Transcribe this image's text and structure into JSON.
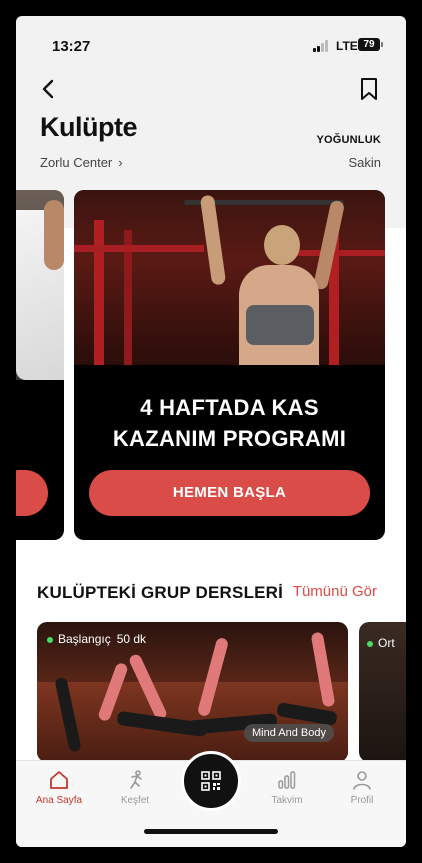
{
  "status_bar": {
    "time": "13:27",
    "network": "LTE",
    "battery": "79"
  },
  "header": {
    "title": "Kulüpte",
    "club_name": "Zorlu Center",
    "density_label": "YOĞUNLUK",
    "density_value": "Sakin"
  },
  "promo_card": {
    "title_line1": "4 HAFTADA KAS",
    "title_line2": "KAZANIM PROGRAMI",
    "button_label": "HEMEN BAŞLA"
  },
  "group_classes": {
    "section_title": "KULÜPTEKİ GRUP DERSLERİ",
    "see_all_label": "Tümünü Gör",
    "cards": [
      {
        "level": "Başlangıç",
        "duration": "50 dk",
        "category": "Mind And Body"
      },
      {
        "level": "Ort"
      }
    ]
  },
  "tab_bar": {
    "items": [
      {
        "label": "Ana Sayfa",
        "icon": "home-icon",
        "active": true
      },
      {
        "label": "Keşfet",
        "icon": "runner-icon",
        "active": false
      },
      {
        "label": "",
        "icon": "qr-code-icon",
        "active": false
      },
      {
        "label": "Takvim",
        "icon": "bars-icon",
        "active": false
      },
      {
        "label": "Profil",
        "icon": "person-icon",
        "active": false
      }
    ]
  },
  "colors": {
    "accent": "#d94c47",
    "active_tab": "#c0392b"
  }
}
